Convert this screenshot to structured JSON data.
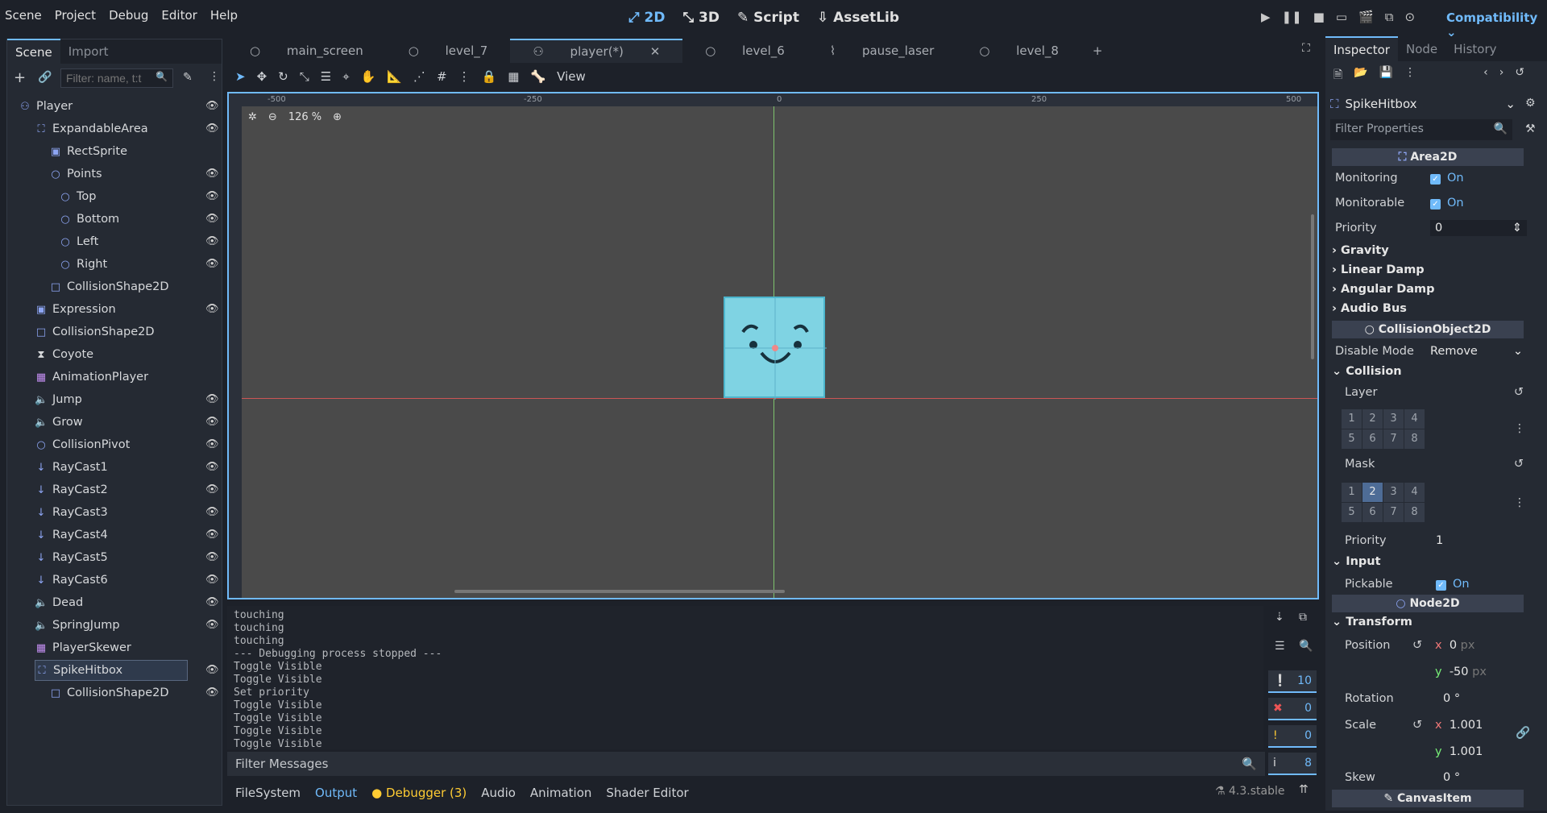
{
  "menu": [
    "Scene",
    "Project",
    "Debug",
    "Editor",
    "Help"
  ],
  "modes": [
    "2D",
    "3D",
    "Script",
    "AssetLib"
  ],
  "compatibility": "Compatibility",
  "scene_dock": {
    "tabs": [
      "Scene",
      "Import"
    ],
    "filter_placeholder": "Filter: name, t:t",
    "tree": [
      {
        "label": "Player",
        "icon": "character-icon"
      },
      {
        "label": "ExpandableArea",
        "icon": "area-icon"
      },
      {
        "label": "RectSprite",
        "icon": "sprite-icon"
      },
      {
        "label": "Points",
        "icon": "node-circle-icon"
      },
      {
        "label": "Top",
        "icon": "node-circle-icon"
      },
      {
        "label": "Bottom",
        "icon": "node-circle-icon"
      },
      {
        "label": "Left",
        "icon": "node-circle-icon"
      },
      {
        "label": "Right",
        "icon": "node-circle-icon"
      },
      {
        "label": "CollisionShape2D",
        "icon": "collision-shape-icon"
      },
      {
        "label": "Expression",
        "icon": "sprite-icon"
      },
      {
        "label": "CollisionShape2D",
        "icon": "collision-shape-icon"
      },
      {
        "label": "Coyote",
        "icon": "timer-icon"
      },
      {
        "label": "AnimationPlayer",
        "icon": "animation-icon"
      },
      {
        "label": "Jump",
        "icon": "audio-icon"
      },
      {
        "label": "Grow",
        "icon": "audio-icon"
      },
      {
        "label": "CollisionPivot",
        "icon": "node-circle-icon"
      },
      {
        "label": "RayCast1",
        "icon": "raycast-icon"
      },
      {
        "label": "RayCast2",
        "icon": "raycast-icon"
      },
      {
        "label": "RayCast3",
        "icon": "raycast-icon"
      },
      {
        "label": "RayCast4",
        "icon": "raycast-icon"
      },
      {
        "label": "RayCast5",
        "icon": "raycast-icon"
      },
      {
        "label": "RayCast6",
        "icon": "raycast-icon"
      },
      {
        "label": "Dead",
        "icon": "audio-icon"
      },
      {
        "label": "SpringJump",
        "icon": "audio-icon"
      },
      {
        "label": "PlayerSkewer",
        "icon": "animation-icon"
      },
      {
        "label": "SpikeHitbox",
        "icon": "area-icon"
      },
      {
        "label": "CollisionShape2D",
        "icon": "collision-shape-icon"
      }
    ]
  },
  "editor_tabs": [
    "main_screen",
    "level_7",
    "player(*)",
    "level_6",
    "pause_laser",
    "level_8"
  ],
  "toolbar": {
    "view_label": "View",
    "zoom": "126 %"
  },
  "ruler": {
    "marks": [
      "-500",
      "-250",
      "0",
      "250",
      "500"
    ]
  },
  "output_lines": [
    "touching",
    "touching",
    "touching",
    "--- Debugging process stopped ---",
    "Toggle Visible",
    "Toggle Visible",
    "Set priority",
    "Toggle Visible",
    "Toggle Visible",
    "Toggle Visible",
    "Toggle Visible"
  ],
  "filter_messages": "Filter Messages",
  "bottom_tabs": [
    "FileSystem",
    "Output",
    "Debugger (3)",
    "Audio",
    "Animation",
    "Shader Editor"
  ],
  "version": "4.3.stable",
  "counters": [
    "10",
    "0",
    "0",
    "8"
  ],
  "inspector": {
    "tabs": [
      "Inspector",
      "Node",
      "History"
    ],
    "node_name": "SpikeHitbox",
    "filter_placeholder": "Filter Properties",
    "area2d": "Area2D",
    "monitoring_label": "Monitoring",
    "monitoring_val": "On",
    "monitorable_label": "Monitorable",
    "monitorable_val": "On",
    "priority_label": "Priority",
    "priority_val": "0",
    "groups": [
      "Gravity",
      "Linear Damp",
      "Angular Damp",
      "Audio Bus"
    ],
    "collision_object": "CollisionObject2D",
    "disable_mode_label": "Disable Mode",
    "disable_mode_val": "Remove",
    "collision": "Collision",
    "layer": "Layer",
    "mask": "Mask",
    "bits": [
      "1",
      "2",
      "3",
      "4",
      "5",
      "6",
      "7",
      "8"
    ],
    "priority2_label": "Priority",
    "priority2_val": "1",
    "input": "Input",
    "pickable_label": "Pickable",
    "pickable_val": "On",
    "node2d": "Node2D",
    "transform": "Transform",
    "position_label": "Position",
    "pos_x": "0",
    "pos_y": "-50",
    "px": "px",
    "rotation_label": "Rotation",
    "rotation_val": "0 °",
    "scale_label": "Scale",
    "scale_x": "1.001",
    "scale_y": "1.001",
    "skew_label": "Skew",
    "skew_val": "0 °",
    "canvas_item": "CanvasItem"
  }
}
